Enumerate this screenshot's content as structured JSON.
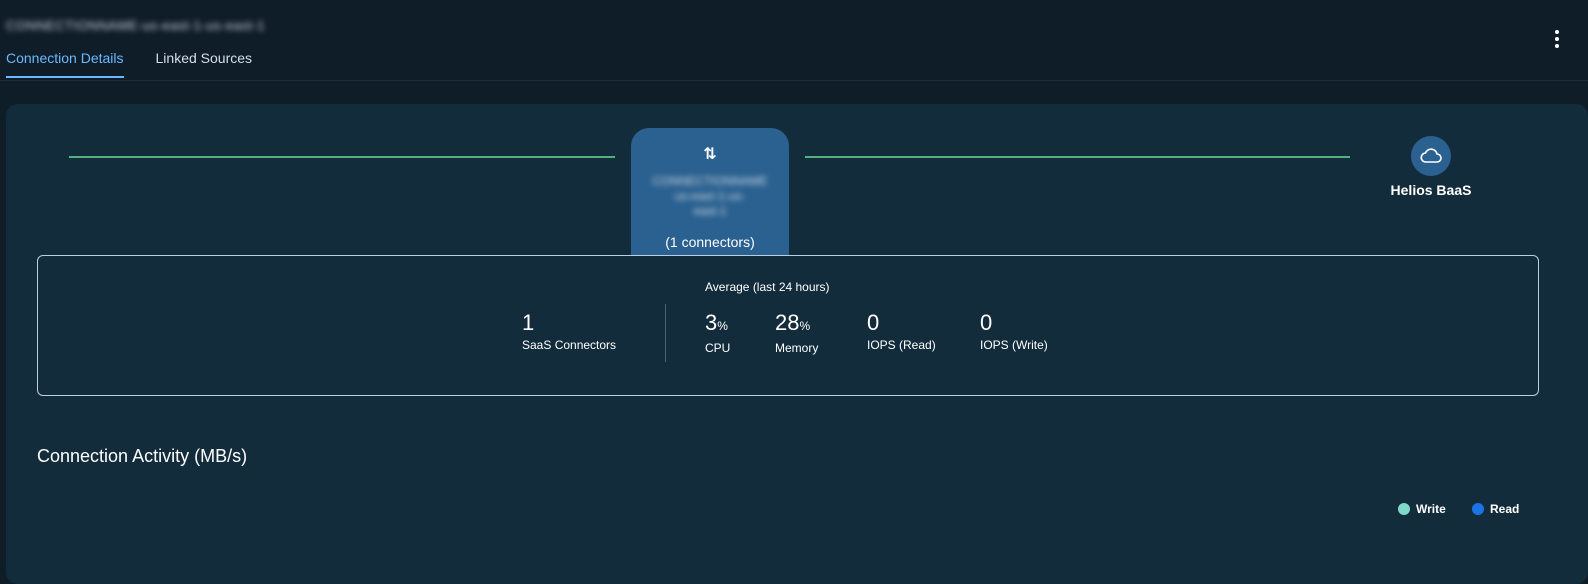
{
  "header": {
    "title": "CONNECTIONNAME-us-east-1-us-east-1",
    "tabs": [
      {
        "label": "Connection Details",
        "active": true
      },
      {
        "label": "Linked Sources",
        "active": false
      }
    ]
  },
  "topology": {
    "center": {
      "icon": "data-transfer-icon",
      "name_line1": "CONNECTIONNAME",
      "name_line2": "us-east-1-us-",
      "name_line3": "east-1",
      "connectors": "(1 connectors)"
    },
    "destination": {
      "icon": "cloud-icon",
      "label": "Helios BaaS"
    },
    "line_color": "#53b27c"
  },
  "stats": {
    "average_label": "Average (last 24 hours)",
    "saas_connectors": {
      "value": "1",
      "label": "SaaS Connectors"
    },
    "cpu": {
      "value": "3",
      "unit": "%",
      "label": "CPU"
    },
    "memory": {
      "value": "28",
      "unit": "%",
      "label": "Memory"
    },
    "iops_read": {
      "value": "0",
      "label": "IOPS (Read)"
    },
    "iops_write": {
      "value": "0",
      "label": "IOPS (Write)"
    }
  },
  "activity": {
    "title": "Connection Activity (MB/s)",
    "legend": [
      {
        "label": "Write",
        "color": "#7fd8c8"
      },
      {
        "label": "Read",
        "color": "#1a74e8"
      }
    ]
  }
}
